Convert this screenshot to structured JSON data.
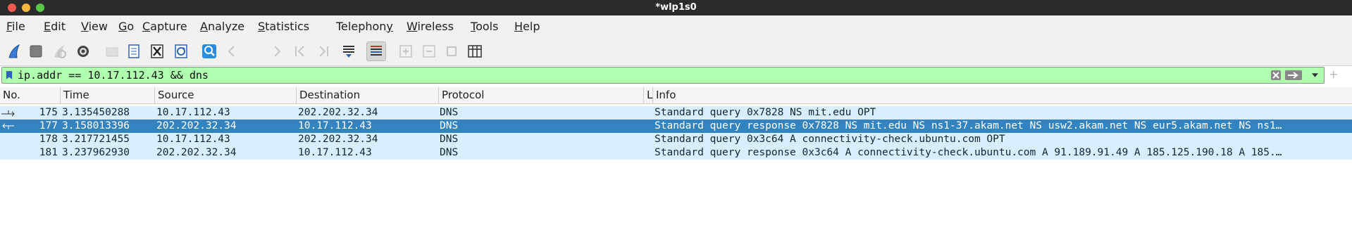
{
  "window": {
    "title": "*wlp1s0"
  },
  "menu": [
    {
      "mnemonic": "F",
      "rest": "ile"
    },
    {
      "mnemonic": "E",
      "rest": "dit"
    },
    {
      "mnemonic": "V",
      "rest": "iew"
    },
    {
      "mnemonic": "G",
      "rest": "o"
    },
    {
      "mnemonic": "C",
      "rest": "apture"
    },
    {
      "mnemonic": "A",
      "rest": "nalyze"
    },
    {
      "mnemonic": "S",
      "rest": "tatistics"
    },
    {
      "mnemonic": "",
      "rest": "Telephony",
      "pre": "Telephon",
      "mnemonic2": "y"
    },
    {
      "mnemonic": "W",
      "rest": "ireless"
    },
    {
      "mnemonic": "T",
      "rest": "ools"
    },
    {
      "mnemonic": "H",
      "rest": "elp"
    }
  ],
  "toolbar": {
    "icons": [
      "start-capture-icon",
      "stop-capture-icon",
      "restart-capture-icon",
      "capture-options-icon",
      "open-file-icon",
      "save-file-icon",
      "close-file-icon",
      "reload-file-icon",
      "find-packet-icon",
      "go-back-icon",
      "go-forward-icon",
      "go-to-first-icon",
      "go-to-last-icon",
      "autoscroll-icon",
      "colorize-icon",
      "zoom-in-icon",
      "zoom-out-icon",
      "normal-size-icon",
      "resize-columns-icon"
    ]
  },
  "filter": {
    "value": "ip.addr == 10.17.112.43 && dns",
    "background": "#afffaf"
  },
  "columns": [
    "No.",
    "Time",
    "Source",
    "Destination",
    "Protocol",
    "L",
    "Info"
  ],
  "packets": [
    {
      "no": "175",
      "time": "3.135450288",
      "src": "10.17.112.43",
      "dst": "202.202.32.34",
      "proto": "DNS",
      "info": "Standard query 0x7828 NS mit.edu OPT",
      "selected": false,
      "relation": "request"
    },
    {
      "no": "177",
      "time": "3.158013396",
      "src": "202.202.32.34",
      "dst": "10.17.112.43",
      "proto": "DNS",
      "info": "Standard query response 0x7828 NS mit.edu NS ns1-37.akam.net NS usw2.akam.net NS eur5.akam.net NS ns1…",
      "selected": true,
      "relation": "response"
    },
    {
      "no": "178",
      "time": "3.217721455",
      "src": "10.17.112.43",
      "dst": "202.202.32.34",
      "proto": "DNS",
      "info": "Standard query 0x3c64 A connectivity-check.ubuntu.com OPT",
      "selected": false,
      "relation": ""
    },
    {
      "no": "181",
      "time": "3.237962930",
      "src": "202.202.32.34",
      "dst": "10.17.112.43",
      "proto": "DNS",
      "info": "Standard query response 0x3c64 A connectivity-check.ubuntu.com A 91.189.91.49 A 185.125.190.18 A 185.…",
      "selected": false,
      "relation": ""
    }
  ],
  "colors": {
    "row_bg": "#daeeff",
    "row_selected": "#3383c1",
    "titlebar": "#2b2b2b"
  }
}
